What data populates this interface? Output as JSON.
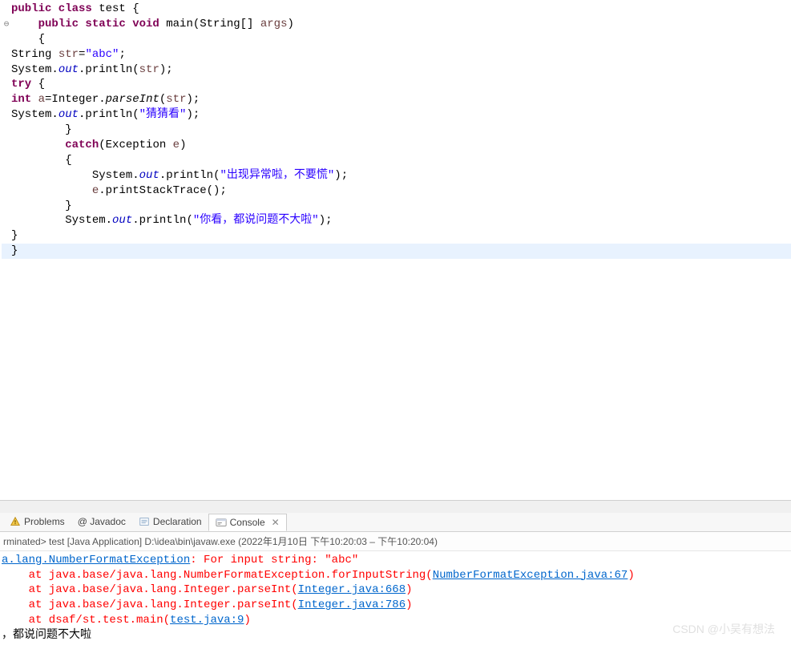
{
  "editor": {
    "fold_marker": "⊖",
    "lines": [
      {
        "indent": "",
        "tokens": [
          {
            "t": "kw",
            "v": "public class"
          },
          {
            "t": "plain",
            "v": " test {"
          }
        ]
      },
      {
        "fold": true,
        "indent": "    ",
        "tokens": [
          {
            "t": "kw",
            "v": "public static void"
          },
          {
            "t": "plain",
            "v": " main(String[] "
          },
          {
            "t": "local",
            "v": "args"
          },
          {
            "t": "plain",
            "v": ")"
          }
        ]
      },
      {
        "indent": "    ",
        "tokens": [
          {
            "t": "plain",
            "v": "{"
          }
        ]
      },
      {
        "indent": "",
        "tokens": [
          {
            "t": "plain",
            "v": "String "
          },
          {
            "t": "local",
            "v": "str"
          },
          {
            "t": "plain",
            "v": "="
          },
          {
            "t": "str",
            "v": "\"abc\""
          },
          {
            "t": "plain",
            "v": ";"
          }
        ]
      },
      {
        "indent": "",
        "tokens": [
          {
            "t": "plain",
            "v": "System."
          },
          {
            "t": "static-field",
            "v": "out"
          },
          {
            "t": "plain",
            "v": ".println("
          },
          {
            "t": "local",
            "v": "str"
          },
          {
            "t": "plain",
            "v": ");"
          }
        ]
      },
      {
        "indent": "",
        "tokens": [
          {
            "t": "kw",
            "v": "try"
          },
          {
            "t": "plain",
            "v": " {"
          }
        ]
      },
      {
        "indent": "",
        "tokens": [
          {
            "t": "kw",
            "v": "int"
          },
          {
            "t": "plain",
            "v": " "
          },
          {
            "t": "local",
            "v": "a"
          },
          {
            "t": "plain",
            "v": "=Integer."
          },
          {
            "t": "method-italic",
            "v": "parseInt"
          },
          {
            "t": "plain",
            "v": "("
          },
          {
            "t": "local",
            "v": "str"
          },
          {
            "t": "plain",
            "v": ");"
          }
        ]
      },
      {
        "indent": "",
        "tokens": [
          {
            "t": "plain",
            "v": "System."
          },
          {
            "t": "static-field",
            "v": "out"
          },
          {
            "t": "plain",
            "v": ".println("
          },
          {
            "t": "str",
            "v": "\"猜猜看\""
          },
          {
            "t": "plain",
            "v": ");"
          }
        ]
      },
      {
        "indent": "        ",
        "tokens": [
          {
            "t": "plain",
            "v": "}"
          }
        ]
      },
      {
        "indent": "        ",
        "tokens": [
          {
            "t": "kw",
            "v": "catch"
          },
          {
            "t": "plain",
            "v": "(Exception "
          },
          {
            "t": "local",
            "v": "e"
          },
          {
            "t": "plain",
            "v": ")"
          }
        ]
      },
      {
        "indent": "        ",
        "tokens": [
          {
            "t": "plain",
            "v": "{"
          }
        ]
      },
      {
        "indent": "            ",
        "tokens": [
          {
            "t": "plain",
            "v": "System."
          },
          {
            "t": "static-field",
            "v": "out"
          },
          {
            "t": "plain",
            "v": ".println("
          },
          {
            "t": "str",
            "v": "\"出现异常啦，不要慌\""
          },
          {
            "t": "plain",
            "v": ");"
          }
        ]
      },
      {
        "indent": "            ",
        "tokens": [
          {
            "t": "local",
            "v": "e"
          },
          {
            "t": "plain",
            "v": ".printStackTrace();"
          }
        ]
      },
      {
        "indent": "        ",
        "tokens": [
          {
            "t": "plain",
            "v": "}"
          }
        ]
      },
      {
        "indent": "        ",
        "tokens": [
          {
            "t": "plain",
            "v": "System."
          },
          {
            "t": "static-field",
            "v": "out"
          },
          {
            "t": "plain",
            "v": ".println("
          },
          {
            "t": "str",
            "v": "\"你看，都说问题不大啦\""
          },
          {
            "t": "plain",
            "v": ");"
          }
        ]
      },
      {
        "indent": "",
        "tokens": [
          {
            "t": "plain",
            "v": "}"
          }
        ]
      },
      {
        "highlight": true,
        "indent": "",
        "tokens": [
          {
            "t": "plain",
            "v": "}"
          }
        ]
      }
    ]
  },
  "tabs": {
    "problems": "Problems",
    "javadoc": "@ Javadoc",
    "declaration": "Declaration",
    "console": "Console",
    "close_x": "✕"
  },
  "console": {
    "header": "rminated> test [Java Application] D:\\idea\\bin\\javaw.exe  (2022年1月10日 下午10:20:03 – 下午10:20:04)",
    "lines": [
      {
        "segments": [
          {
            "t": "link",
            "v": "a.lang.NumberFormatException"
          },
          {
            "t": "err",
            "v": ": For input string: \"abc\""
          }
        ]
      },
      {
        "segments": [
          {
            "t": "err",
            "v": "    at java.base/java.lang.NumberFormatException.forInputString("
          },
          {
            "t": "link",
            "v": "NumberFormatException.java:67"
          },
          {
            "t": "err",
            "v": ")"
          }
        ]
      },
      {
        "segments": [
          {
            "t": "err",
            "v": "    at java.base/java.lang.Integer.parseInt("
          },
          {
            "t": "link",
            "v": "Integer.java:668"
          },
          {
            "t": "err",
            "v": ")"
          }
        ]
      },
      {
        "segments": [
          {
            "t": "err",
            "v": "    at java.base/java.lang.Integer.parseInt("
          },
          {
            "t": "link",
            "v": "Integer.java:786"
          },
          {
            "t": "err",
            "v": ")"
          }
        ]
      },
      {
        "segments": [
          {
            "t": "err",
            "v": "    at dsaf/st.test.main("
          },
          {
            "t": "link",
            "v": "test.java:9"
          },
          {
            "t": "err",
            "v": ")"
          }
        ]
      },
      {
        "segments": [
          {
            "t": "plain",
            "v": "，都说问题不大啦"
          }
        ]
      }
    ]
  },
  "watermark": "CSDN @小吴有想法"
}
